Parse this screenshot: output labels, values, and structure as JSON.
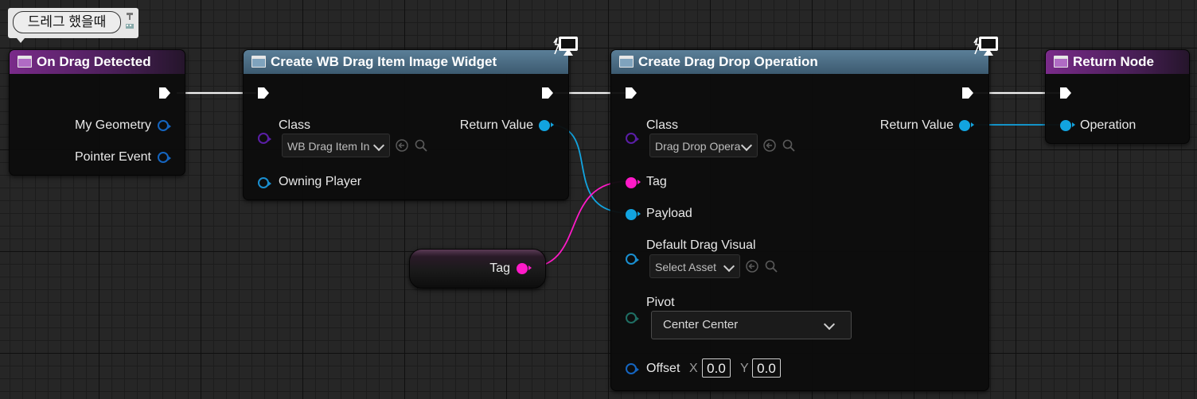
{
  "comment": {
    "text": "드레그 했을때"
  },
  "nodes": {
    "on_drag_detected": {
      "title": "On Drag Detected",
      "pins": {
        "geometry": "My Geometry",
        "pointer": "Pointer Event"
      }
    },
    "create_widget": {
      "title": "Create WB Drag Item Image Widget",
      "class_label": "Class",
      "class_value": "WB Drag Item In",
      "owning_player": "Owning Player",
      "return_value": "Return Value"
    },
    "create_drag_drop": {
      "title": "Create Drag Drop Operation",
      "class_label": "Class",
      "class_value": "Drag Drop Opera",
      "return_value": "Return Value",
      "tag": "Tag",
      "payload": "Payload",
      "default_drag_visual": "Default Drag Visual",
      "default_drag_visual_value": "Select Asset",
      "pivot": "Pivot",
      "pivot_value": "Center Center",
      "offset": "Offset",
      "offset_x_label": "X",
      "offset_x": "0.0",
      "offset_y_label": "Y",
      "offset_y": "0.0"
    },
    "return_node": {
      "title": "Return Node",
      "operation": "Operation"
    },
    "tag_variable": {
      "label": "Tag"
    }
  },
  "icons": [
    "function-node-icon",
    "event-node-icon",
    "exec-pin-icon",
    "monitor-icon",
    "browse-arrow-icon",
    "search-icon",
    "comment-pin-icon",
    "chevron-down-icon"
  ],
  "colors": {
    "event_header": "#7a2b8a",
    "function_header": "#4e7088",
    "object_pin": "#12a4e0",
    "string_pin": "#ff1ac8",
    "class_pin": "#5a1ea6",
    "enum_pin": "#1f6e63",
    "exec_wire": "#ffffff",
    "background": "#262626"
  }
}
